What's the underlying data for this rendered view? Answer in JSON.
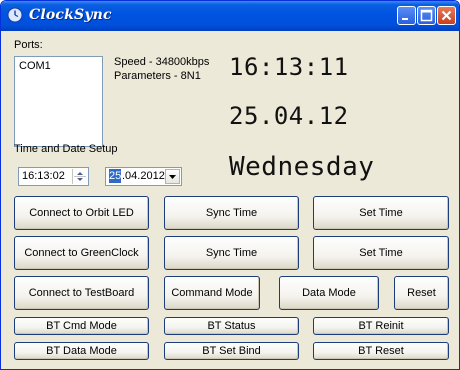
{
  "window": {
    "title": "ClockSync"
  },
  "ports": {
    "label": "Ports:",
    "items": [
      "COM1"
    ]
  },
  "connection": {
    "speed": "Speed - 34800kbps",
    "parameters": "Parameters - 8N1"
  },
  "display": {
    "time": "16:13:11",
    "date": "25.04.12",
    "weekday": "Wednesday"
  },
  "setup": {
    "label": "Time and Date Setup",
    "time_value": "16:13:02",
    "date_day": "25",
    "date_rest": ".04.2012"
  },
  "rows": [
    {
      "connect": "Connect to Orbit LED",
      "sync": "Sync Time",
      "set": "Set Time"
    },
    {
      "connect": "Connect to GreenClock",
      "sync": "Sync Time",
      "set": "Set Time"
    }
  ],
  "testboard": {
    "connect": "Connect to TestBoard",
    "command_mode": "Command Mode",
    "data_mode": "Data Mode",
    "reset": "Reset"
  },
  "bt": {
    "cmd_mode": "BT Cmd Mode",
    "status": "BT Status",
    "reinit": "BT Reinit",
    "data_mode": "BT Data Mode",
    "set_bind": "BT Set Bind",
    "reset": "BT Reset"
  }
}
